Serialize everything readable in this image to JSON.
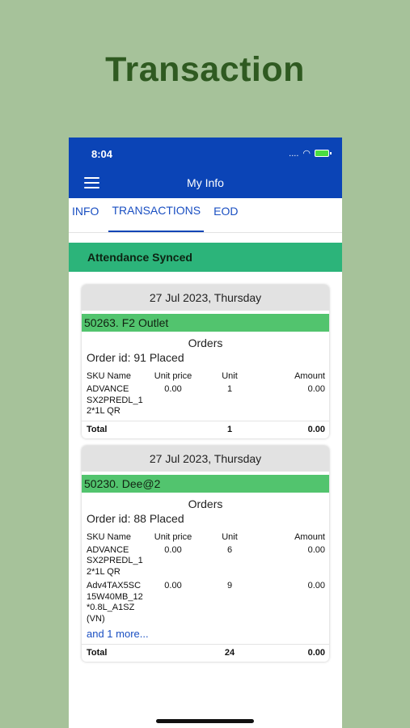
{
  "promo": {
    "title": "Transaction"
  },
  "status_bar": {
    "time": "8:04",
    "signal": "....",
    "wifi_icon": "wifi-icon",
    "battery_icon": "battery-charging-icon"
  },
  "header": {
    "title": "My Info",
    "menu_icon": "hamburger-menu-icon",
    "color": "#0b44b6"
  },
  "tabs": [
    {
      "label": "INFO",
      "active": false
    },
    {
      "label": "TRANSACTIONS",
      "active": true
    },
    {
      "label": "EOD",
      "active": false
    }
  ],
  "banner": {
    "text": "Attendance Synced",
    "color": "#2cb47a"
  },
  "columns": {
    "sku": "SKU Name",
    "price": "Unit price",
    "unit": "Unit",
    "amount": "Amount"
  },
  "total_label": "Total",
  "cards": [
    {
      "date": "27 Jul 2023, Thursday",
      "outlet": "50263. F2 Outlet",
      "section": "Orders",
      "order_id": "Order id: 91 Placed",
      "rows": [
        {
          "sku": "ADVANCE SX2PREDL_1 2*1L QR",
          "price": "0.00",
          "unit": "1",
          "amount": "0.00"
        }
      ],
      "total_unit": "1",
      "total_amount": "0.00"
    },
    {
      "date": "27 Jul 2023, Thursday",
      "outlet": "50230. Dee@2",
      "section": "Orders",
      "order_id": "Order id: 88 Placed",
      "rows": [
        {
          "sku": "ADVANCE SX2PREDL_1 2*1L QR",
          "price": "0.00",
          "unit": "6",
          "amount": "0.00"
        },
        {
          "sku": "Adv4TAX5SC 15W40MB_12 *0.8L_A1SZ (VN)",
          "price": "0.00",
          "unit": "9",
          "amount": "0.00"
        }
      ],
      "more": "and 1 more...",
      "total_unit": "24",
      "total_amount": "0.00"
    }
  ]
}
